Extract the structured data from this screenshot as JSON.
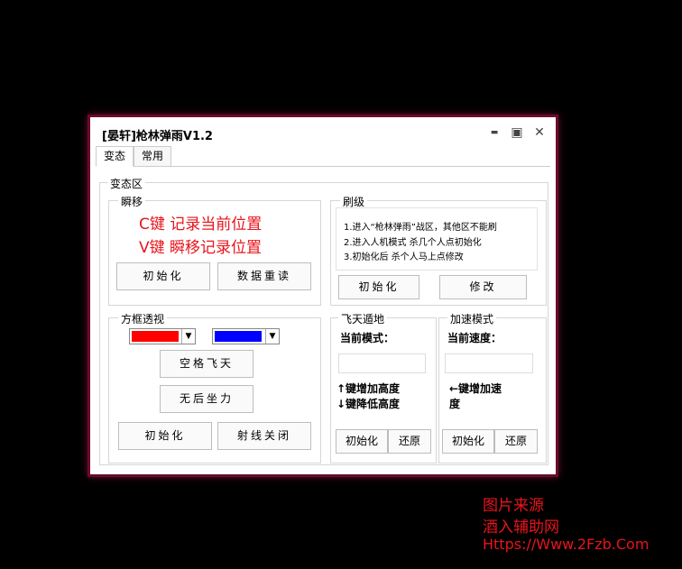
{
  "window": {
    "title": "[晏轩]枪林弹雨V1.2",
    "minimize_glyph": "▬",
    "maximize_glyph": "▣",
    "close_glyph": "✕"
  },
  "tabs": [
    {
      "label": "变态",
      "active": true
    },
    {
      "label": "常用",
      "active": false
    }
  ],
  "main_group": {
    "label": "变态区"
  },
  "teleport": {
    "label": "瞬移",
    "hint1": "C键 记录当前位置",
    "hint2": "V键 瞬移记录位置",
    "init_button": "初始化",
    "reload_button": "数据重读"
  },
  "brush": {
    "label": "刷级",
    "notes": [
      "1.进入“枪林弹雨”战区，其他区不能刷",
      "2.进入人机模式 杀几个人点初始化",
      "3.初始化后 杀个人马上点修改"
    ],
    "init_button": "初始化",
    "modify_button": "修改"
  },
  "esp": {
    "label": "方框透视",
    "color1": "#ff0000",
    "color2": "#0000ff",
    "space_fly_button": "空格飞天",
    "no_recoil_button": "无后坐力",
    "init_button": "初始化",
    "ray_off_button": "射线关闭"
  },
  "fly": {
    "label": "飞天遁地",
    "mode_label": "当前模式：",
    "mode_value": "",
    "up_hint": "↑键增加高度",
    "down_hint": "↓键降低高度",
    "init_button": "初始化",
    "restore_button": "还原"
  },
  "speed": {
    "label": "加速模式",
    "speed_label": "当前速度：",
    "speed_value": "",
    "hint_line1": "←键增加速",
    "hint_line2": "度",
    "init_button": "初始化",
    "restore_button": "还原"
  },
  "watermark": {
    "line1": "图片来源",
    "line2": "酒入辅助网",
    "line3": "Https://Www.2Fzb.Com"
  }
}
